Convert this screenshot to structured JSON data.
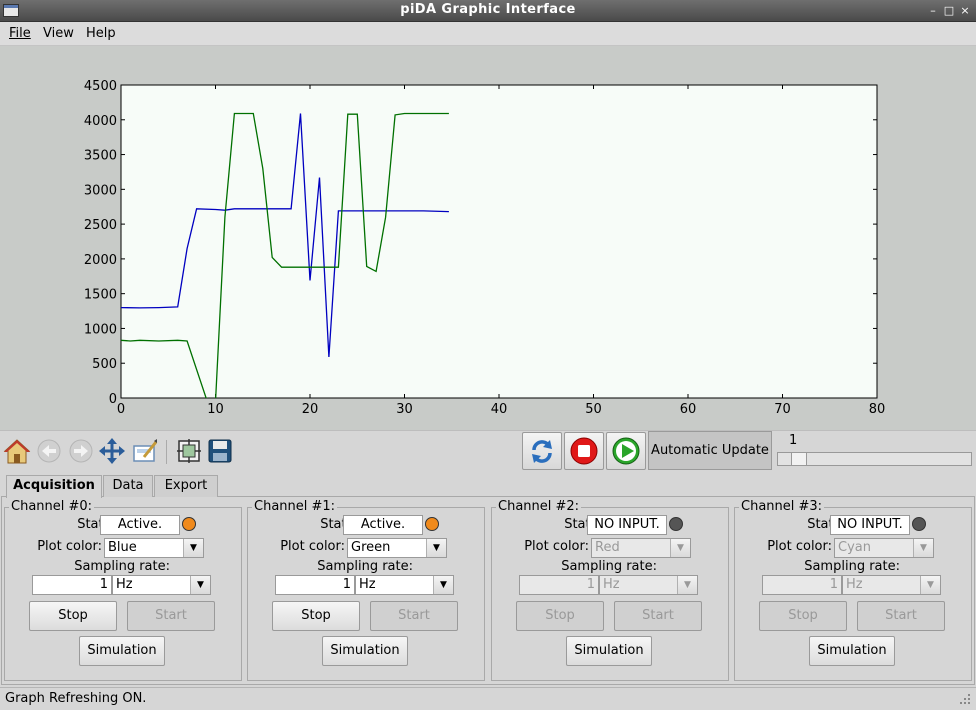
{
  "window": {
    "title": "piDA Graphic Interface"
  },
  "menu": [
    {
      "label": "File",
      "mnemonic": "F"
    },
    {
      "label": "View",
      "mnemonic": "V"
    },
    {
      "label": "Help",
      "mnemonic": "H"
    }
  ],
  "chart_data": {
    "type": "line",
    "xlim": [
      0,
      80
    ],
    "ylim": [
      0,
      4500
    ],
    "xticks": [
      0,
      10,
      20,
      30,
      40,
      50,
      60,
      70,
      80
    ],
    "yticks": [
      0,
      500,
      1000,
      1500,
      2000,
      2500,
      3000,
      3500,
      4000,
      4500
    ],
    "grid": false,
    "series": [
      {
        "color": "#0000c0",
        "x": [
          0,
          2,
          4,
          6,
          7,
          8,
          10,
          11,
          12,
          14,
          16,
          18,
          19,
          20,
          21,
          22,
          23,
          25,
          27,
          30,
          32,
          34.7
        ],
        "y": [
          1300,
          1295,
          1300,
          1310,
          2150,
          2720,
          2710,
          2700,
          2720,
          2720,
          2720,
          2720,
          4090,
          1690,
          3170,
          590,
          2690,
          2690,
          2690,
          2690,
          2690,
          2680
        ]
      },
      {
        "color": "#007000",
        "x": [
          0,
          1,
          2,
          4,
          6,
          7,
          9,
          10,
          11,
          12,
          13,
          14,
          15,
          16,
          17,
          19,
          21,
          23,
          24,
          25,
          26,
          27,
          28,
          29,
          30,
          32,
          34.7
        ],
        "y": [
          830,
          820,
          830,
          820,
          830,
          820,
          0,
          -50,
          2600,
          4090,
          4090,
          4090,
          3300,
          2020,
          1880,
          1880,
          1880,
          1880,
          4080,
          4080,
          1890,
          1820,
          2600,
          4070,
          4090,
          4090,
          4090
        ]
      }
    ]
  },
  "toolbar": {
    "icons": [
      "home-icon",
      "back-arrow-icon",
      "forward-arrow-icon",
      "pan-move-icon",
      "zoom-rect-icon",
      "configure-subplots-icon",
      "save-disk-icon"
    ],
    "auto_update_label": "Automatic Update",
    "slider_value": "1",
    "slider_fraction": 0.08
  },
  "tabs": [
    {
      "label": "Acquisition",
      "active": true
    },
    {
      "label": "Data",
      "active": false
    },
    {
      "label": "Export",
      "active": false
    }
  ],
  "channels": [
    {
      "title": "Channel #0:",
      "status_label": "Status:",
      "status": "Active.",
      "led_color": "#f08a1c",
      "plot_color_label": "Plot color:",
      "plot_color": "Blue",
      "rate_label": "Sampling rate:",
      "rate_value": "1",
      "rate_unit": "Hz",
      "stop": "Stop",
      "start": "Start",
      "simulation": "Simulation",
      "enabled": true
    },
    {
      "title": "Channel #1:",
      "status_label": "Status:",
      "status": "Active.",
      "led_color": "#f08a1c",
      "plot_color_label": "Plot color:",
      "plot_color": "Green",
      "rate_label": "Sampling rate:",
      "rate_value": "1",
      "rate_unit": "Hz",
      "stop": "Stop",
      "start": "Start",
      "simulation": "Simulation",
      "enabled": true
    },
    {
      "title": "Channel #2:",
      "status_label": "Status:",
      "status": "NO INPUT.",
      "led_color": "#555555",
      "plot_color_label": "Plot color:",
      "plot_color": "Red",
      "rate_label": "Sampling rate:",
      "rate_value": "1",
      "rate_unit": "Hz",
      "stop": "Stop",
      "start": "Start",
      "simulation": "Simulation",
      "enabled": false
    },
    {
      "title": "Channel #3:",
      "status_label": "Status:",
      "status": "NO INPUT.",
      "led_color": "#555555",
      "plot_color_label": "Plot color:",
      "plot_color": "Cyan",
      "rate_label": "Sampling rate:",
      "rate_value": "1",
      "rate_unit": "Hz",
      "stop": "Stop",
      "start": "Start",
      "simulation": "Simulation",
      "enabled": false
    }
  ],
  "statusbar": {
    "text": "Graph Refreshing ON."
  }
}
